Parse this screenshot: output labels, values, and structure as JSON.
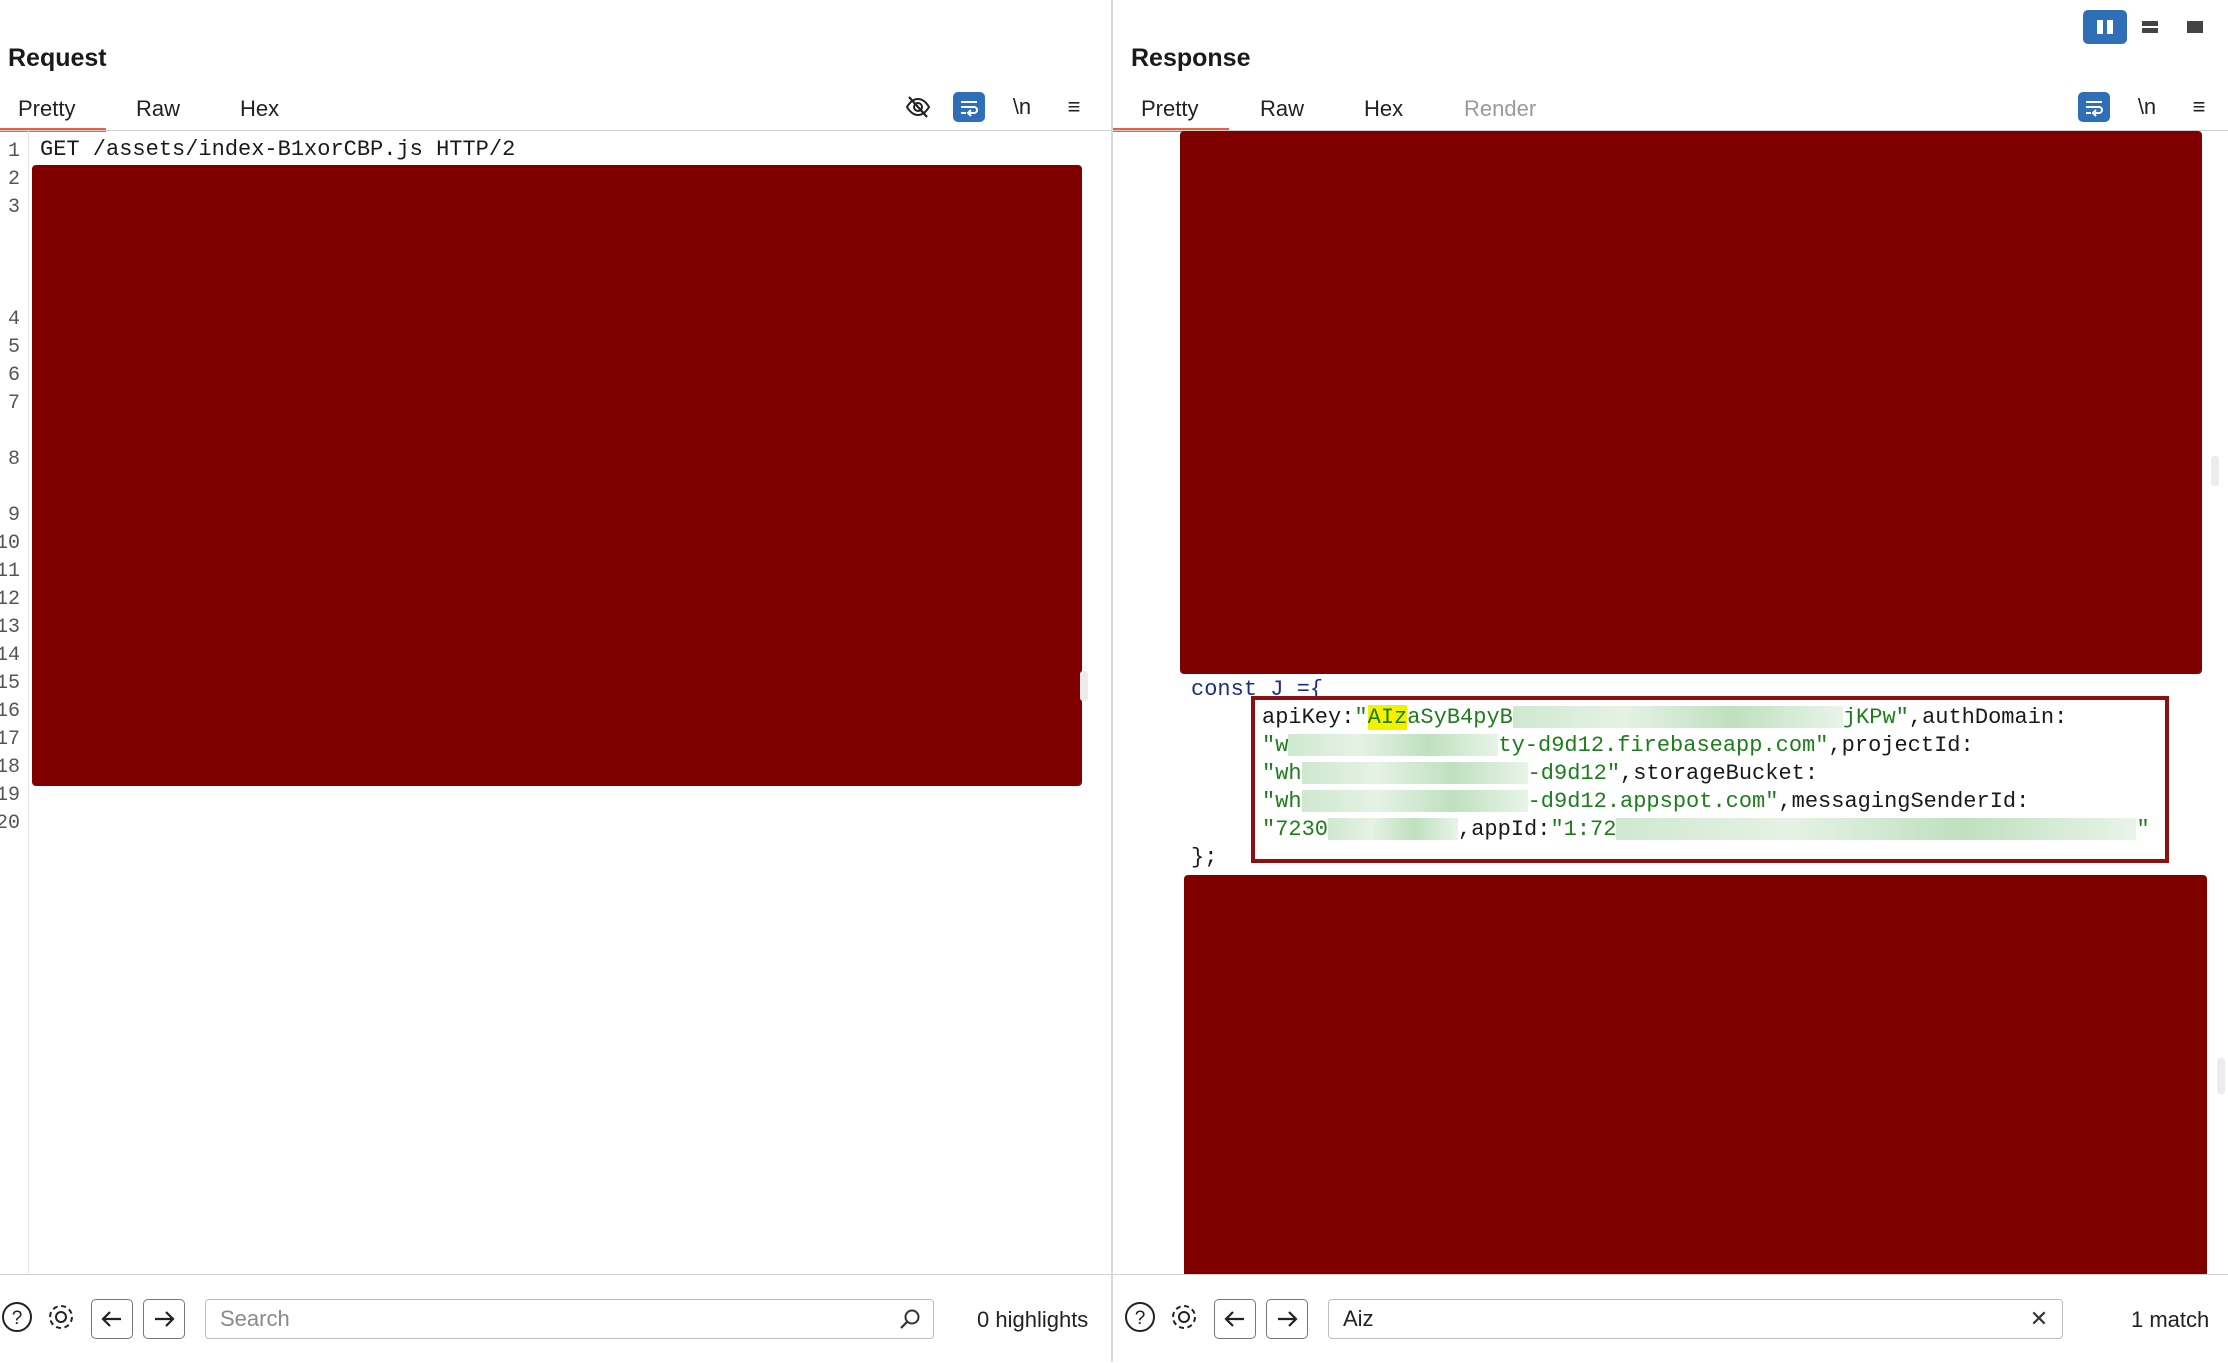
{
  "request": {
    "title": "Request",
    "tabs": [
      "Pretty",
      "Raw",
      "Hex"
    ],
    "active_tab": "Pretty",
    "tools": [
      "eye-off-icon",
      "wrap-lines-icon",
      "newline-toggle",
      "menu-icon"
    ],
    "newline_label": "\\n",
    "menu_label": "≡",
    "line_numbers": [
      "1",
      "2",
      "3",
      "4",
      "5",
      "6",
      "7",
      "8",
      "9",
      "10",
      "11",
      "12",
      "13",
      "14",
      "15",
      "16",
      "17",
      "18",
      "19",
      "20"
    ],
    "first_line": "GET /assets/index-B1xorCBP.js HTTP/2",
    "search": {
      "placeholder": "Search",
      "value": ""
    },
    "status": "0 highlights"
  },
  "response": {
    "title": "Response",
    "tabs": [
      "Pretty",
      "Raw",
      "Hex",
      "Render"
    ],
    "active_tab": "Pretty",
    "tools": [
      "wrap-lines-icon",
      "newline-toggle",
      "menu-icon"
    ],
    "newline_label": "\\n",
    "menu_label": "≡",
    "code": {
      "line1": "const J ={",
      "api_key_label": "apiKey:",
      "api_key_quote": "\"",
      "api_key_match": "AIz",
      "api_key_visible": "aSyB4pyB",
      "api_key_tail": "jKPw\"",
      "auth_domain_label": ",authDomain:",
      "auth_domain_start": "\"w",
      "auth_domain_tail": "ty-d9d12.firebaseapp.com\"",
      "project_id_label": ",projectId:",
      "project_id_start": "\"wh",
      "project_id_tail": "-d9d12\"",
      "storage_bucket_label": ",storageBucket:",
      "storage_bucket_start": "\"wh",
      "storage_bucket_tail": "-d9d12.appspot.com\"",
      "messaging_label": ",messagingSenderId:",
      "messaging_start": "\"7230",
      "app_id_label": ",appId:",
      "app_id_start": "\"1:72",
      "app_id_end": "\"",
      "closing": "};"
    },
    "search": {
      "placeholder": "Search",
      "value": "Aiz"
    },
    "clear_label": "✕",
    "status": "1 match"
  },
  "layout_toggles": [
    "split-columns-icon",
    "split-rows-icon",
    "single-pane-icon"
  ],
  "colors": {
    "accent": "#2f6fb8",
    "tab_underline": "#e8603c",
    "redaction": "#800000",
    "outline": "#8c1010",
    "string": "#1a7f1a",
    "keyword": "#1b2e8a",
    "highlight": "#f4f000"
  }
}
